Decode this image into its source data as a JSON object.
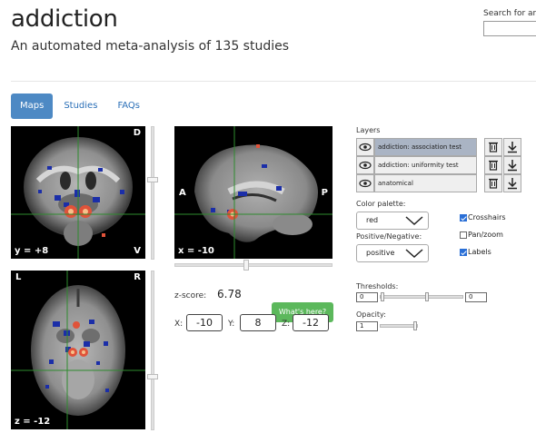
{
  "header": {
    "title": "addiction",
    "subtitle": "An automated meta-analysis of 135 studies",
    "search_label": "Search for anot"
  },
  "tabs": [
    {
      "label": "Maps",
      "active": true
    },
    {
      "label": "Studies",
      "active": false
    },
    {
      "label": "FAQs",
      "active": false
    }
  ],
  "viewers": {
    "coronal": {
      "top_right": "D",
      "bottom_left": "y = +8",
      "bottom_right": "V"
    },
    "sagittal": {
      "left": "A",
      "right": "P",
      "bottom_left": "x = -10"
    },
    "axial": {
      "top_left": "L",
      "top_right": "R",
      "bottom_left": "z = -12"
    }
  },
  "zscore": {
    "label": "z-score:",
    "value": "6.78",
    "button": "What's here?"
  },
  "coords": {
    "x_label": "X:",
    "x": "-10",
    "y_label": "Y:",
    "y": "8",
    "z_label": "Z:",
    "z": "-12"
  },
  "layers": {
    "label": "Layers",
    "items": [
      {
        "name": "addiction: association test",
        "selected": true
      },
      {
        "name": "addiction: uniformity test",
        "selected": false
      },
      {
        "name": "anatomical",
        "selected": false
      }
    ]
  },
  "palette": {
    "label": "Color palette:",
    "value": "red"
  },
  "posneg": {
    "label": "Positive/Negative:",
    "value": "positive"
  },
  "options": {
    "crosshairs": {
      "label": "Crosshairs",
      "checked": true
    },
    "panzoom": {
      "label": "Pan/zoom",
      "checked": false
    },
    "labels": {
      "label": "Labels",
      "checked": true
    }
  },
  "thresholds": {
    "label": "Thresholds:",
    "min": "0",
    "max": "0"
  },
  "opacity": {
    "label": "Opacity:",
    "value": "1"
  },
  "colors": {
    "accent": "#4d89c4",
    "link": "#2a6fb7",
    "crosshair": "#2e8b2e",
    "button_green": "#5cb85c"
  }
}
